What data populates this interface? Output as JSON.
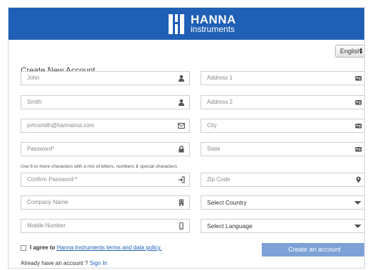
{
  "brand": {
    "name": "HANNA",
    "sub": "instruments"
  },
  "language_select": {
    "value": "English"
  },
  "form": {
    "title": "Create New Account",
    "fields": {
      "first_name": {
        "placeholder": "John",
        "icon": "user-icon"
      },
      "last_name": {
        "placeholder": "Smith",
        "icon": "user-icon"
      },
      "email": {
        "placeholder": "johnsmith@hannainst.com",
        "icon": "envelope-icon"
      },
      "password": {
        "placeholder": "Password*",
        "icon": "lock-icon"
      },
      "confirm_password": {
        "placeholder": "Confirm Password *",
        "icon": "sign-in-icon"
      },
      "company": {
        "placeholder": "Company Name",
        "icon": "building-icon"
      },
      "mobile": {
        "placeholder": "Mobile Number",
        "icon": "mobile-icon"
      },
      "address1": {
        "placeholder": "Address 1",
        "icon": "address-card-icon"
      },
      "address2": {
        "placeholder": "Address 2",
        "icon": "address-card-icon"
      },
      "city": {
        "placeholder": "City",
        "icon": "address-card-icon"
      },
      "state": {
        "placeholder": "State",
        "icon": "address-card-icon"
      },
      "zip": {
        "placeholder": "Zip Code",
        "icon": "map-marker-icon"
      },
      "country": {
        "value": "Select Country"
      },
      "language": {
        "value": "Select Language"
      }
    },
    "password_hint": "Use 8 or more characters with a mix of letters, numbers & special characters",
    "agree": {
      "prefix": "I agree to",
      "link": "Hanna Instruments terms and data policy."
    },
    "create_button": "Create an account",
    "signin": {
      "prefix": "Already have an account ?",
      "link": "Sign In"
    }
  },
  "colors": {
    "header": "#1f5fb5",
    "button": "#7da1d6",
    "link": "#1f5fb5"
  }
}
